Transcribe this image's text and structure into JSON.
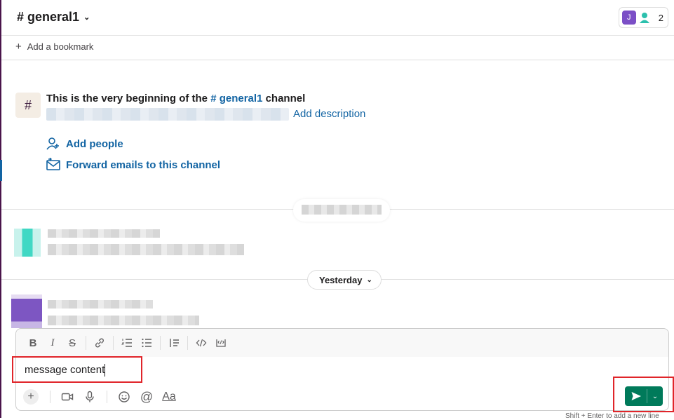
{
  "header": {
    "channel_title": "# general1",
    "member_initial": "J",
    "member_count": "2"
  },
  "bookmarks": {
    "add_label": "Add a bookmark"
  },
  "intro": {
    "prefix": "This is the very beginning of the ",
    "channel_link": "# general1",
    "suffix": " channel",
    "add_description": "Add description",
    "add_people": "Add people",
    "forward_emails": "Forward emails to this channel"
  },
  "date_divider": {
    "label": "Yesterday"
  },
  "composer": {
    "message_value": "message content",
    "hint": "Shift + Enter to add a new line"
  },
  "colors": {
    "link": "#1264a3",
    "send_button": "#007a5a",
    "highlight": "#e0252a",
    "sidebar": "#4a154b"
  },
  "icons": {
    "toolbar": [
      "bold-icon",
      "italic-icon",
      "strikethrough-icon",
      "link-icon",
      "ordered-list-icon",
      "bulleted-list-icon",
      "blockquote-icon",
      "code-icon",
      "code-block-icon"
    ],
    "bottom": [
      "plus-icon",
      "video-icon",
      "microphone-icon",
      "emoji-icon",
      "mention-icon",
      "formatting-icon"
    ]
  }
}
